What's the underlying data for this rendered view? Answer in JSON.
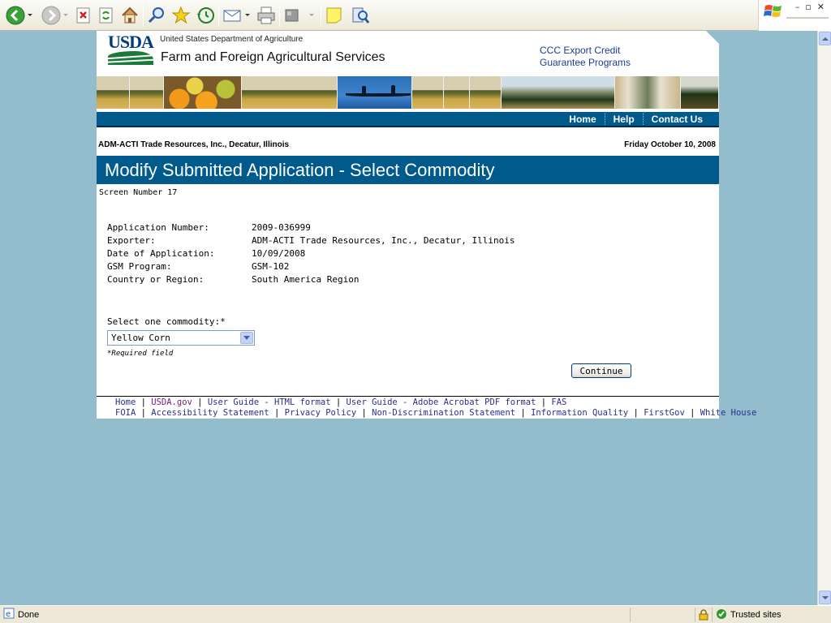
{
  "toolbar": {
    "buttons": [
      "back-icon",
      "forward-icon",
      "stop-icon",
      "refresh-icon",
      "home-icon",
      "search-icon",
      "favorites-icon",
      "history-icon",
      "mail-icon",
      "print-icon",
      "edit-icon",
      "discuss-icon",
      "research-icon"
    ]
  },
  "window": {
    "minimize": "–",
    "restore": "▫",
    "close": "✕"
  },
  "header": {
    "logo": "USDA",
    "department": "United States Department of Agriculture",
    "agency": "Farm and Foreign Agricultural Services",
    "program_line1": "CCC Export Credit",
    "program_line2": "Guarantee Programs"
  },
  "nav": {
    "home": "Home",
    "help": "Help",
    "contact": "Contact Us"
  },
  "info": {
    "exporter": "ADM-ACTI Trade Resources, Inc., Decatur, Illinois",
    "date": "Friday October 10, 2008"
  },
  "page": {
    "title": "Modify Submitted Application - Select Commodity",
    "screen_number": "Screen Number 17"
  },
  "details": [
    {
      "label": "Application Number:",
      "value": "2009-036999"
    },
    {
      "label": "Exporter:",
      "value": "ADM-ACTI Trade Resources, Inc., Decatur, Illinois"
    },
    {
      "label": "Date of Application:",
      "value": "10/09/2008"
    },
    {
      "label": "GSM Program:",
      "value": "GSM-102"
    },
    {
      "label": "Country or Region:",
      "value": "South America Region"
    }
  ],
  "form": {
    "commodity_label": "Select one commodity:*",
    "commodity_selected": "Yellow Corn",
    "required_note": "*Required field",
    "continue_label": "Continue"
  },
  "footer": {
    "line1": [
      "Home",
      "USDA.gov",
      "User Guide - HTML format",
      "User Guide - Adobe Acrobat PDF format",
      "FAS"
    ],
    "line2": [
      "FOIA",
      "Accessibility Statement",
      "Privacy Policy",
      "Non-Discrimination Statement",
      "Information Quality",
      "FirstGov",
      "White House"
    ]
  },
  "status": {
    "text": "Done",
    "zone": "Trusted sites"
  }
}
